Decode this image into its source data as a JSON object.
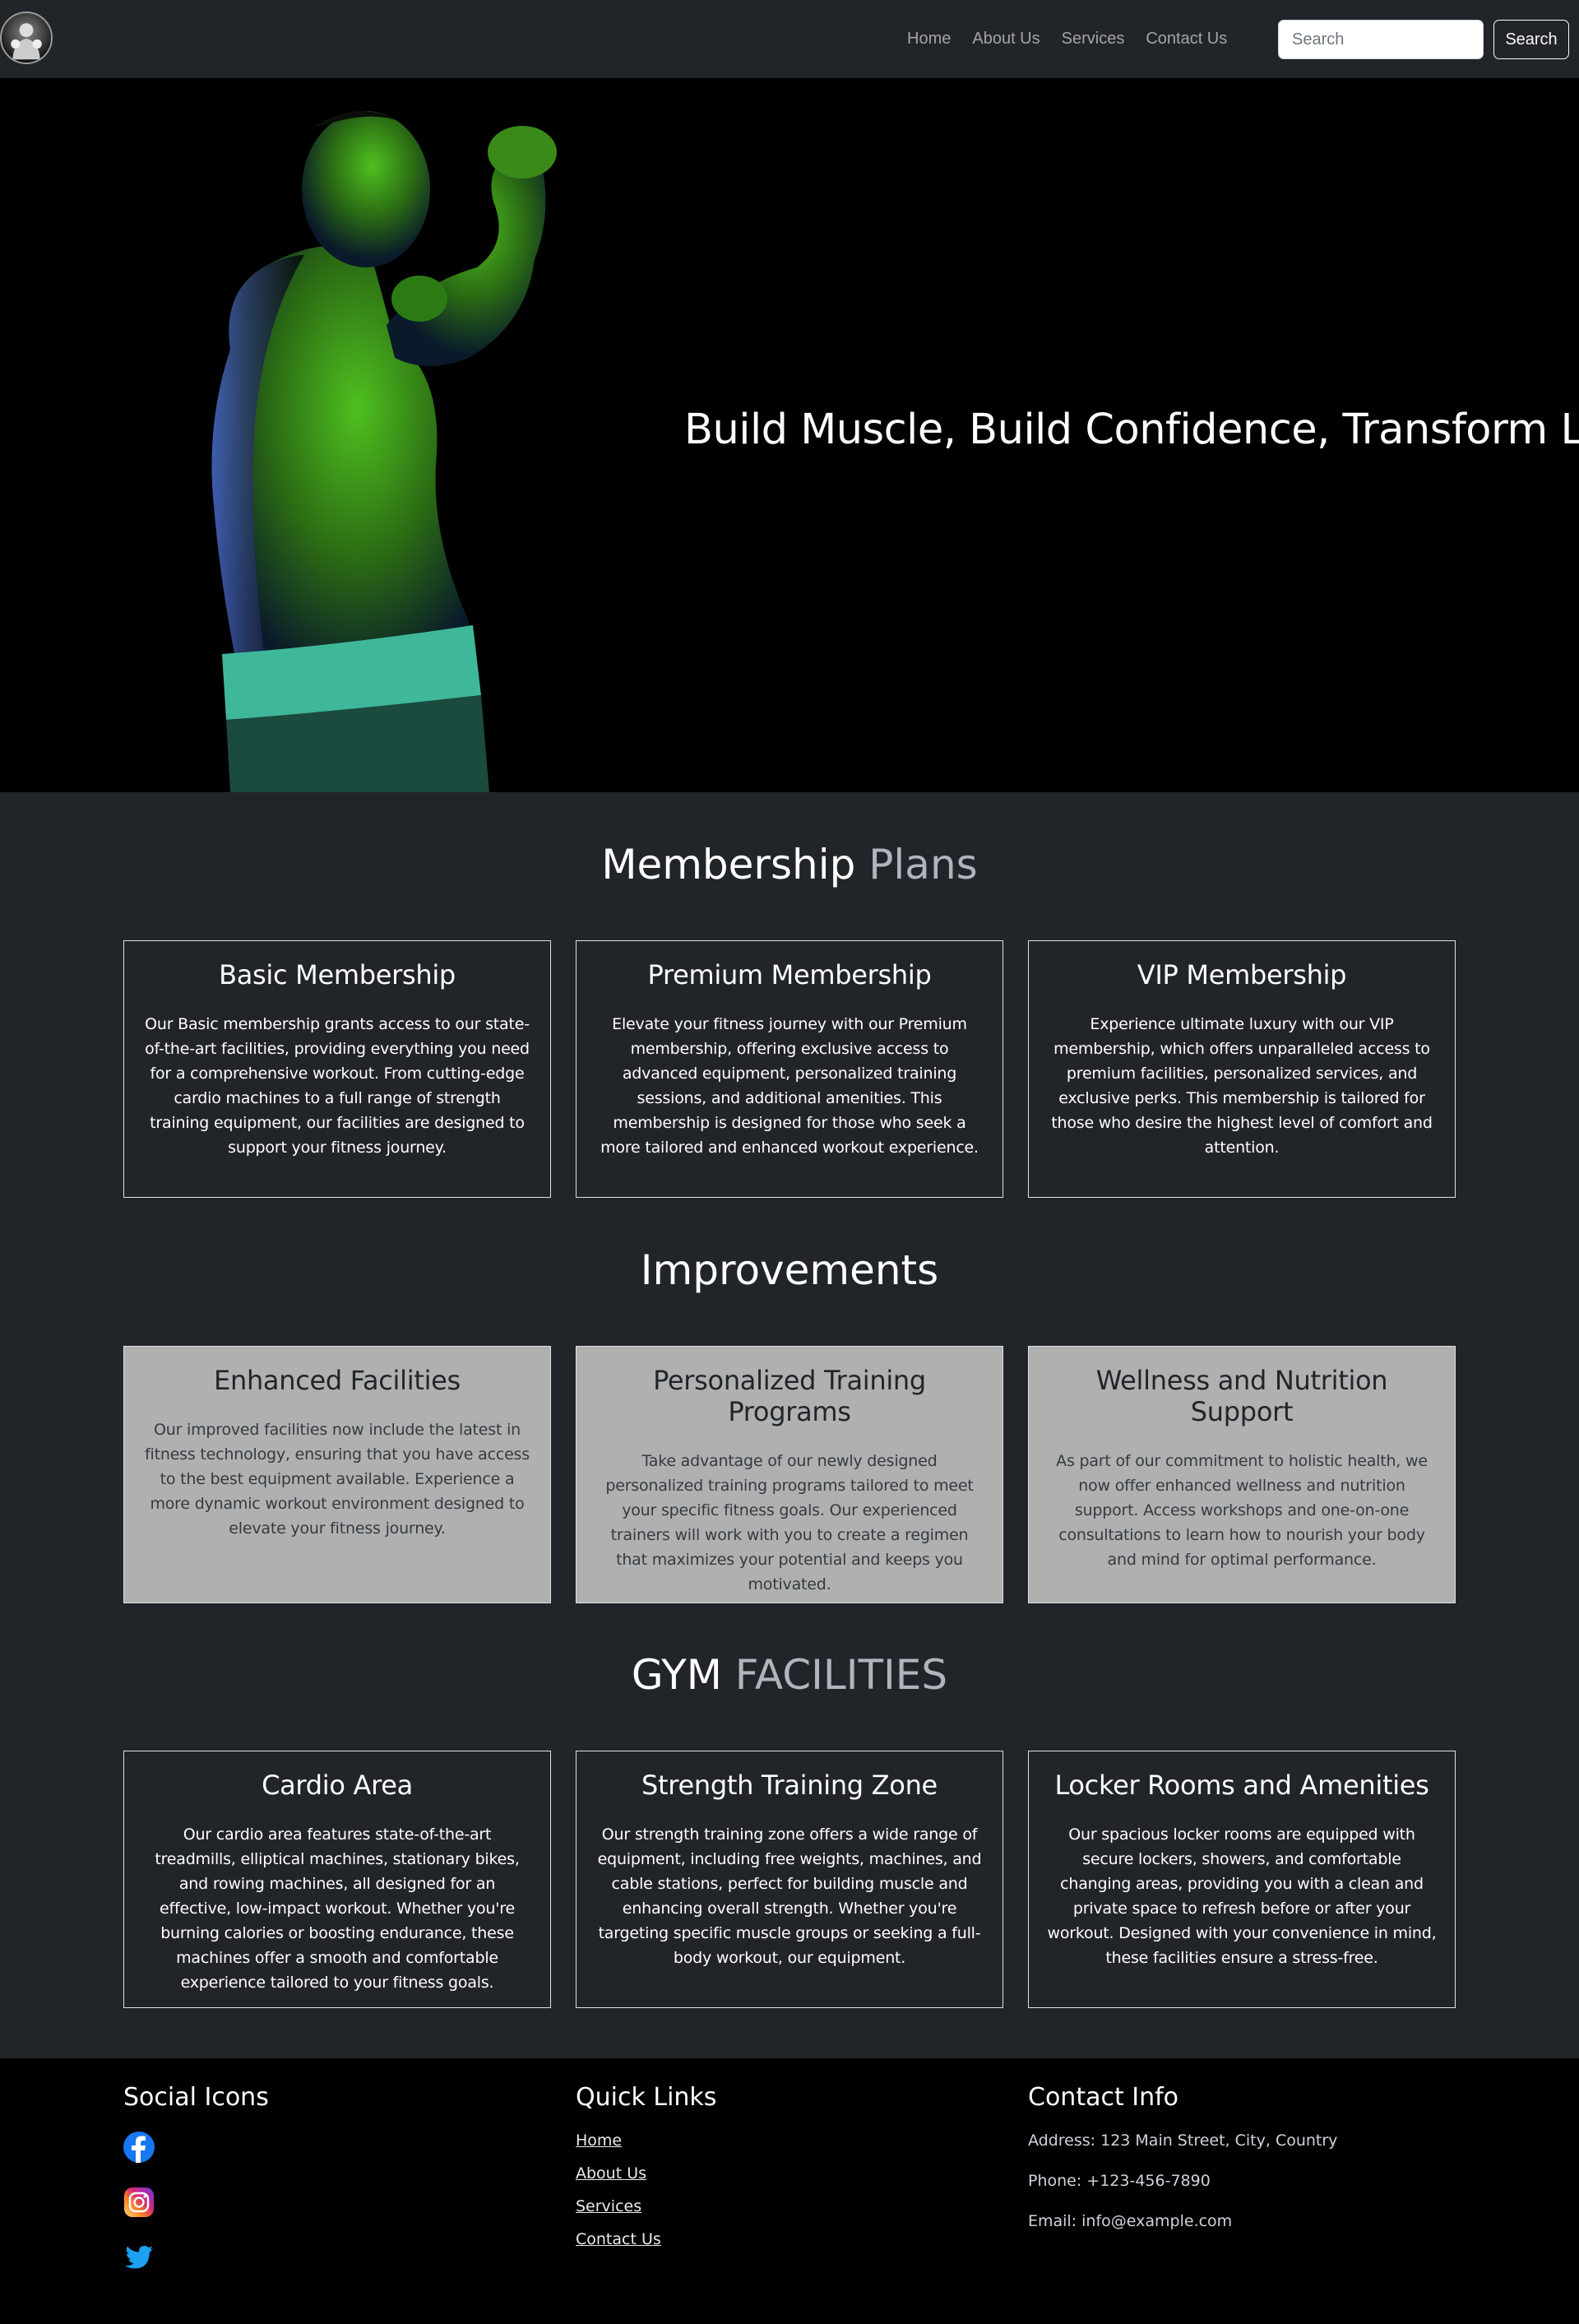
{
  "nav": {
    "links": [
      "Home",
      "About Us",
      "Services",
      "Contact Us"
    ],
    "search_placeholder": "Search",
    "search_button": "Search"
  },
  "hero": {
    "title": "Build Muscle, Build Confidence, Transform Life"
  },
  "membership": {
    "title_main": "Membership",
    "title_muted": "Plans",
    "cards": [
      {
        "title": "Basic Membership",
        "text": "Our Basic membership grants access to our state-of-the-art facilities, providing everything you need for a comprehensive workout. From cutting-edge cardio machines to a full range of strength training equipment, our facilities are designed to support your fitness journey."
      },
      {
        "title": "Premium Membership",
        "text": "Elevate your fitness journey with our Premium membership, offering exclusive access to advanced equipment, personalized training sessions, and additional amenities. This membership is designed for those who seek a more tailored and enhanced workout experience."
      },
      {
        "title": "VIP Membership",
        "text": "Experience ultimate luxury with our VIP membership, which offers unparalleled access to premium facilities, personalized services, and exclusive perks. This membership is tailored for those who desire the highest level of comfort and attention."
      }
    ]
  },
  "improvements": {
    "title": "Improvements",
    "cards": [
      {
        "title": "Enhanced Facilities",
        "text": "Our improved facilities now include the latest in fitness technology, ensuring that you have access to the best equipment available. Experience a more dynamic workout environment designed to elevate your fitness journey."
      },
      {
        "title": "Personalized Training Programs",
        "text": "Take advantage of our newly designed personalized training programs tailored to meet your specific fitness goals. Our experienced trainers will work with you to create a regimen that maximizes your potential and keeps you motivated."
      },
      {
        "title": "Wellness and Nutrition Support",
        "text": "As part of our commitment to holistic health, we now offer enhanced wellness and nutrition support. Access workshops and one-on-one consultations to learn how to nourish your body and mind for optimal performance."
      }
    ]
  },
  "facilities": {
    "title_main": "GYM",
    "title_muted": "FACILITIES",
    "cards": [
      {
        "title": "Cardio Area",
        "text": "Our cardio area features state-of-the-art treadmills, elliptical machines, stationary bikes, and rowing machines, all designed for an effective, low-impact workout. Whether you're burning calories or boosting endurance, these machines offer a smooth and comfortable experience tailored to your fitness goals."
      },
      {
        "title": "Strength Training Zone",
        "text": "Our strength training zone offers a wide range of equipment, including free weights, machines, and cable stations, perfect for building muscle and enhancing overall strength. Whether you're targeting specific muscle groups or seeking a full-body workout, our equipment."
      },
      {
        "title": "Locker Rooms and Amenities",
        "text": "Our spacious locker rooms are equipped with secure lockers, showers, and comfortable changing areas, providing you with a clean and private space to refresh before or after your workout. Designed with your convenience in mind, these facilities ensure a stress-free."
      }
    ]
  },
  "footer": {
    "social_title": "Social Icons",
    "social_icons": [
      "facebook-icon",
      "instagram-icon",
      "twitter-icon"
    ],
    "links_title": "Quick Links",
    "links": [
      "Home",
      "About Us",
      "Services",
      "Contact Us"
    ],
    "contact_title": "Contact Info",
    "address": "Address: 123 Main Street, City, Country",
    "phone": "Phone: +123-456-7890",
    "email": "Email: info@example.com"
  },
  "colors": {
    "page_bg": "#212529",
    "hero_bg": "#000000",
    "improvement_card_bg": "#b0b0b0",
    "facebook_blue": "#1877f2",
    "twitter_blue": "#1da1f2"
  }
}
